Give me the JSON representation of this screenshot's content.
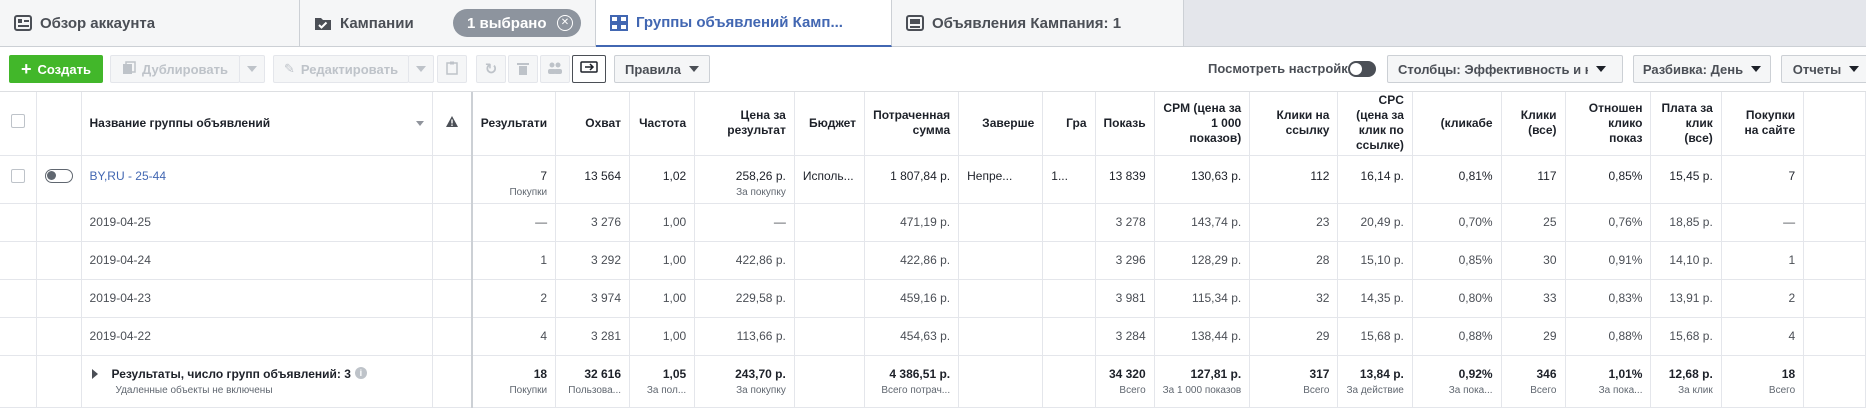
{
  "tabs": [
    {
      "label": "Обзор аккаунта",
      "icon": "account-overview-icon"
    },
    {
      "label": "Кампании",
      "icon": "campaign-folder-icon",
      "selected_pill": "1 выбрано"
    },
    {
      "label": "Группы объявлений Камп...",
      "icon": "ad-sets-grid-icon",
      "active": true
    },
    {
      "label": "Объявления Кампания: 1",
      "icon": "ads-icon"
    }
  ],
  "toolbar": {
    "create": "Создать",
    "duplicate": "Дублировать",
    "edit": "Редактировать",
    "rules": "Правила",
    "view_settings": "Посмотреть настройки",
    "columns": "Столбцы: Эффективность и клик",
    "breakdown": "Разбивка: День",
    "reports": "Отчеты"
  },
  "columns": [
    "Название группы объявлений",
    "Результати",
    "Охват",
    "Частота",
    "Цена за результат",
    "Бюджет",
    "Потраченная сумма",
    "Заверше",
    "Гра",
    "Показь",
    "CPM (цена за 1 000 показов)",
    "Клики на ссылку",
    "CPC (цена за клик по ссылке)",
    "(кликабе",
    "Клики (все)",
    "Отношен клико показ",
    "Плата за клик (все)",
    "Покупки на сайте"
  ],
  "main_row": {
    "name": "BY,RU - 25-44",
    "results": "7",
    "results_sub": "Покупки",
    "reach": "13 564",
    "frequency": "1,02",
    "cost_per_result": "258,26 р.",
    "cost_per_result_sub": "За покупку",
    "budget": "Исполь...",
    "spent": "1 807,84 р.",
    "ends": "Непре...",
    "schedule": "1...",
    "impressions": "13 839",
    "cpm": "130,63 р.",
    "link_clicks": "112",
    "cpc": "16,14 р.",
    "ctr": "0,81%",
    "clicks_all": "117",
    "ctr_all": "0,85%",
    "cpc_all": "15,45 р.",
    "purchases": "7"
  },
  "sub_rows": [
    {
      "date": "2019-04-25",
      "results": "—",
      "reach": "3 276",
      "frequency": "1,00",
      "cost_per_result": "—",
      "spent": "471,19 р.",
      "impressions": "3 278",
      "cpm": "143,74 р.",
      "link_clicks": "23",
      "cpc": "20,49 р.",
      "ctr": "0,70%",
      "clicks_all": "25",
      "ctr_all": "0,76%",
      "cpc_all": "18,85 р.",
      "purchases": "—"
    },
    {
      "date": "2019-04-24",
      "results": "1",
      "reach": "3 292",
      "frequency": "1,00",
      "cost_per_result": "422,86 р.",
      "spent": "422,86 р.",
      "impressions": "3 296",
      "cpm": "128,29 р.",
      "link_clicks": "28",
      "cpc": "15,10 р.",
      "ctr": "0,85%",
      "clicks_all": "30",
      "ctr_all": "0,91%",
      "cpc_all": "14,10 р.",
      "purchases": "1"
    },
    {
      "date": "2019-04-23",
      "results": "2",
      "reach": "3 974",
      "frequency": "1,00",
      "cost_per_result": "229,58 р.",
      "spent": "459,16 р.",
      "impressions": "3 981",
      "cpm": "115,34 р.",
      "link_clicks": "32",
      "cpc": "14,35 р.",
      "ctr": "0,80%",
      "clicks_all": "33",
      "ctr_all": "0,83%",
      "cpc_all": "13,91 р.",
      "purchases": "2"
    },
    {
      "date": "2019-04-22",
      "results": "4",
      "reach": "3 281",
      "frequency": "1,00",
      "cost_per_result": "113,66 р.",
      "spent": "454,63 р.",
      "impressions": "3 284",
      "cpm": "138,44 р.",
      "link_clicks": "29",
      "cpc": "15,68 р.",
      "ctr": "0,88%",
      "clicks_all": "29",
      "ctr_all": "0,88%",
      "cpc_all": "15,68 р.",
      "purchases": "4"
    }
  ],
  "totals": {
    "label": "Результаты, число групп объявлений: 3",
    "note": "Удаленные объекты не включены",
    "results": "18",
    "results_sub": "Покупки",
    "reach": "32 616",
    "reach_sub": "Пользова...",
    "frequency": "1,05",
    "frequency_sub": "За пол...",
    "cost_per_result": "243,70 р.",
    "cost_per_result_sub": "За покупку",
    "spent": "4 386,51 р.",
    "spent_sub": "Всего потрач...",
    "impressions": "34 320",
    "impressions_sub": "Всего",
    "cpm": "127,81 р.",
    "cpm_sub": "За 1 000 показов",
    "link_clicks": "317",
    "link_clicks_sub": "Всего",
    "cpc": "13,84 р.",
    "cpc_sub": "За действие",
    "ctr": "0,92%",
    "ctr_sub": "За пока...",
    "clicks_all": "346",
    "clicks_all_sub": "Всего",
    "ctr_all": "1,01%",
    "ctr_all_sub": "За пока...",
    "cpc_all": "12,68 р.",
    "cpc_all_sub": "За клик",
    "purchases": "18",
    "purchases_sub": "Всего"
  },
  "colors": {
    "accent": "#4267b2",
    "create": "#42b72a"
  }
}
